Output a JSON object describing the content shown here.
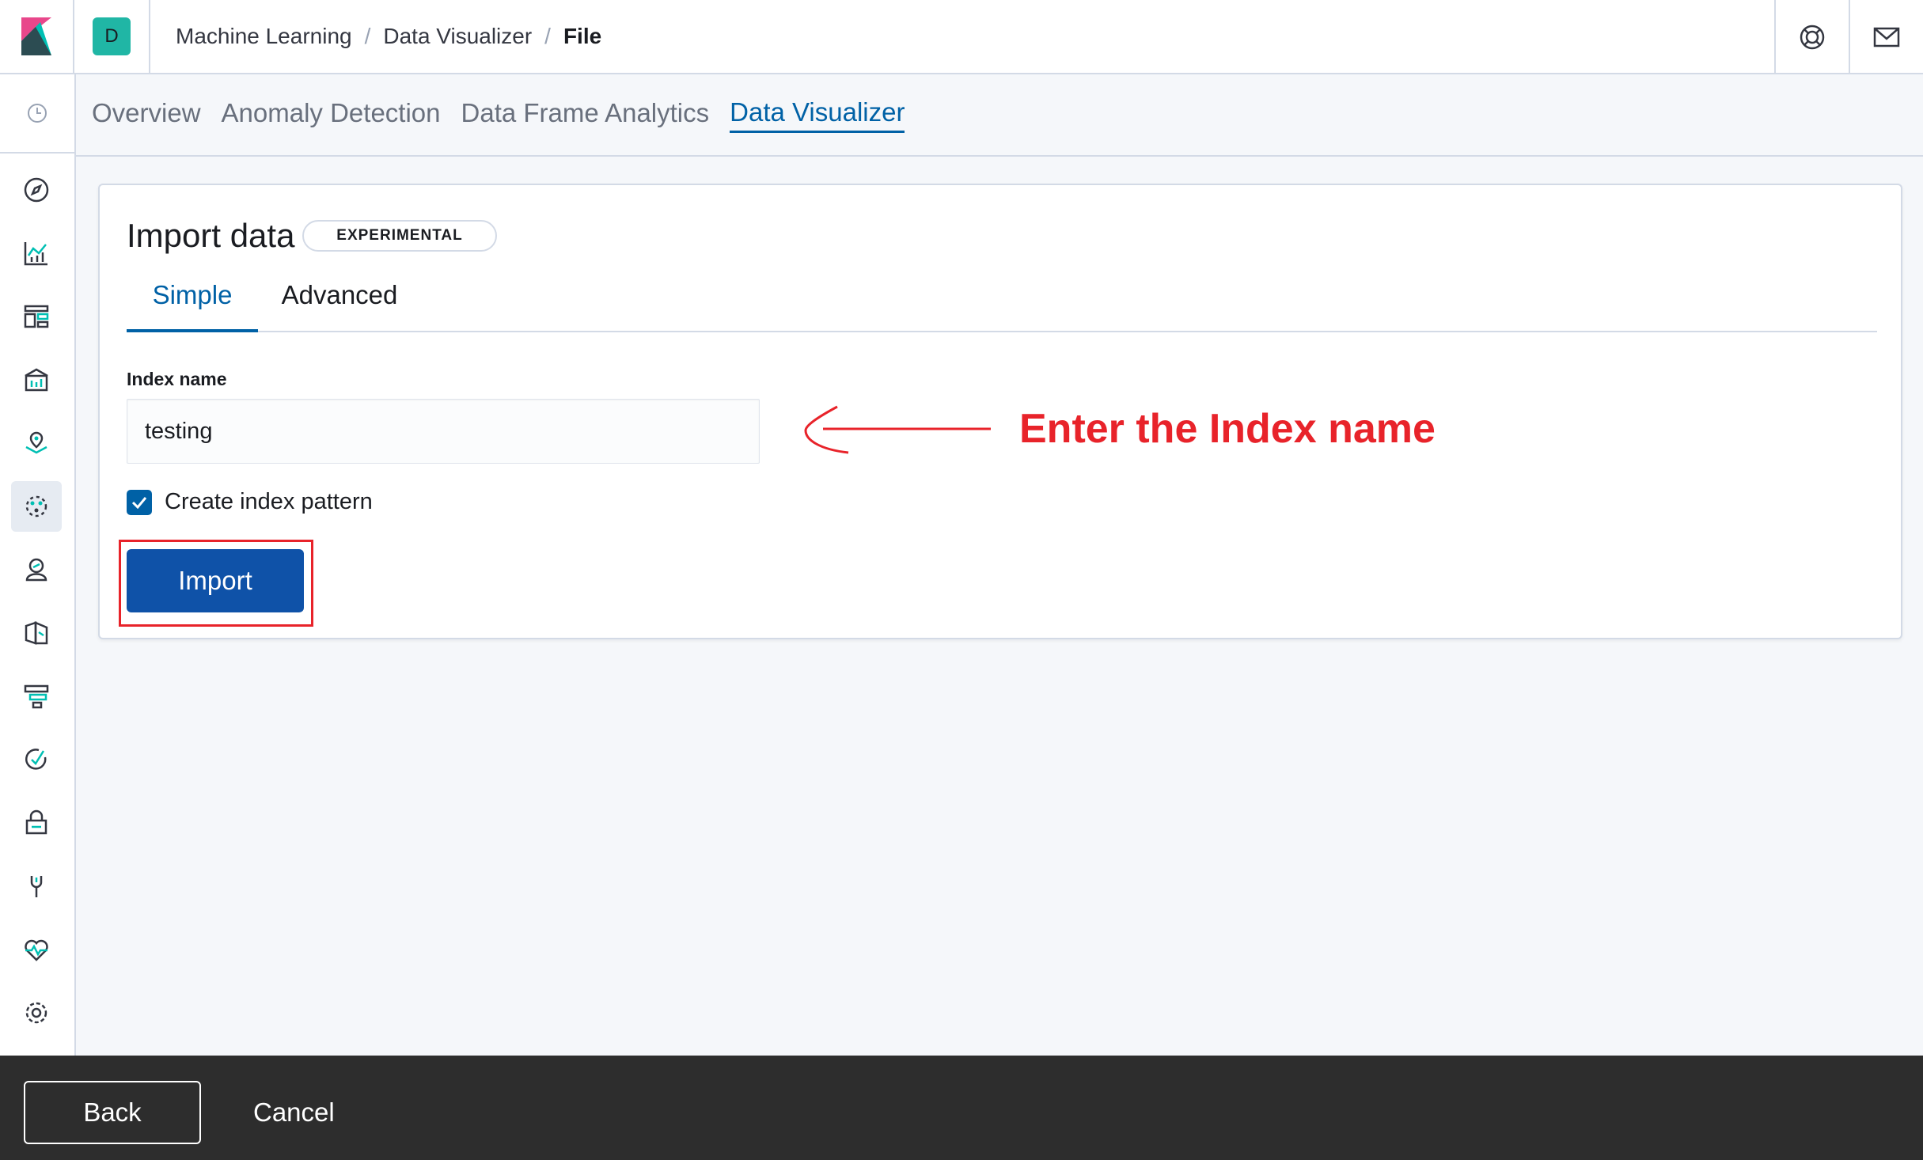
{
  "space": {
    "initial": "D"
  },
  "breadcrumbs": [
    "Machine Learning",
    "Data Visualizer",
    "File"
  ],
  "header_icons": [
    "help-icon",
    "mail-icon"
  ],
  "sidenav": {
    "items": [
      "recent-icon",
      "discover-icon",
      "visualize-icon",
      "dashboard-icon",
      "canvas-icon",
      "maps-icon",
      "ml-icon",
      "metrics-icon",
      "logs-icon",
      "apm-icon",
      "uptime-icon",
      "siem-icon",
      "dev-tools-icon",
      "monitoring-icon",
      "management-icon"
    ]
  },
  "ml_tabs": [
    "Overview",
    "Anomaly Detection",
    "Data Frame Analytics",
    "Data Visualizer"
  ],
  "panel": {
    "title": "Import data",
    "badge": "EXPERIMENTAL",
    "tabs": [
      "Simple",
      "Advanced"
    ],
    "index_label": "Index name",
    "index_value": "testing",
    "checkbox_label": "Create index pattern",
    "checkbox_checked": true,
    "import_label": "Import"
  },
  "annotation": {
    "text": "Enter the Index name",
    "color": "#e8232a"
  },
  "footer": {
    "back_label": "Back",
    "cancel_label": "Cancel"
  },
  "colors": {
    "accent": "#0061a6",
    "button": "#0f52a8",
    "space": "#20b6a5"
  }
}
